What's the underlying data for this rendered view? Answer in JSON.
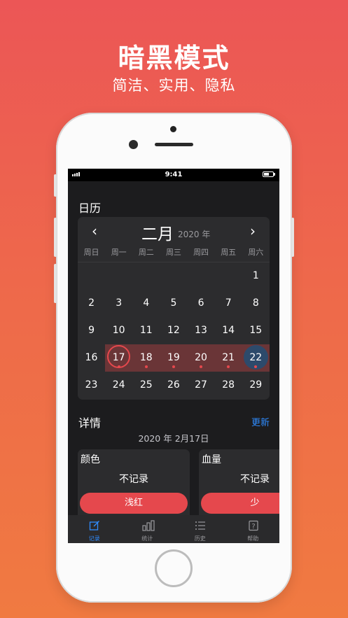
{
  "hero": {
    "title": "暗黑模式",
    "subtitle": "简洁、实用、隐私"
  },
  "status_bar": {
    "time": "9:41"
  },
  "calendar": {
    "section_title": "日历",
    "month": "二月",
    "year": "2020 年",
    "prev_label": "‹",
    "next_label": "›",
    "weekdays": [
      "周日",
      "周一",
      "周二",
      "周三",
      "周四",
      "周五",
      "周六"
    ],
    "rows": [
      [
        "",
        "",
        "",
        "",
        "",
        "",
        "1"
      ],
      [
        "2",
        "3",
        "4",
        "5",
        "6",
        "7",
        "8"
      ],
      [
        "9",
        "10",
        "11",
        "12",
        "13",
        "14",
        "15"
      ],
      [
        "16",
        "17",
        "18",
        "19",
        "20",
        "21",
        "22"
      ],
      [
        "23",
        "24",
        "25",
        "26",
        "27",
        "28",
        "29"
      ]
    ],
    "colors": {
      "period_band": "#6a3537",
      "accent": "#e5484d",
      "today": "#2d4a6b"
    }
  },
  "details": {
    "section_title": "详情",
    "update_label": "更新",
    "date": "2020 年 2月17日",
    "cards": [
      {
        "title": "颜色",
        "value": "不记录",
        "button": "浅红"
      },
      {
        "title": "血量",
        "value": "不记录",
        "button": "少"
      }
    ]
  },
  "tabs": [
    {
      "label": "记录",
      "icon": "edit-icon",
      "active": true
    },
    {
      "label": "统计",
      "icon": "bar-chart-icon",
      "active": false
    },
    {
      "label": "历史",
      "icon": "list-icon",
      "active": false
    },
    {
      "label": "帮助",
      "icon": "help-icon",
      "active": false
    }
  ]
}
